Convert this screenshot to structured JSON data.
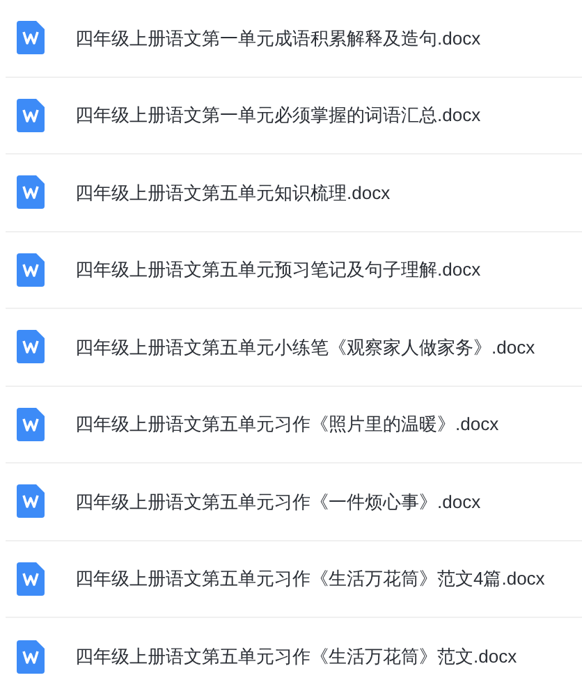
{
  "files": [
    {
      "name": "四年级上册语文第一单元成语积累解释及造句.docx"
    },
    {
      "name": "四年级上册语文第一单元必须掌握的词语汇总.docx"
    },
    {
      "name": "四年级上册语文第五单元知识梳理.docx"
    },
    {
      "name": "四年级上册语文第五单元预习笔记及句子理解.docx"
    },
    {
      "name": "四年级上册语文第五单元小练笔《观察家人做家务》.docx"
    },
    {
      "name": "四年级上册语文第五单元习作《照片里的温暖》.docx"
    },
    {
      "name": "四年级上册语文第五单元习作《一件烦心事》.docx"
    },
    {
      "name": "四年级上册语文第五单元习作《生活万花筒》范文4篇.docx"
    },
    {
      "name": "四年级上册语文第五单元习作《生活万花筒》范文.docx"
    }
  ]
}
